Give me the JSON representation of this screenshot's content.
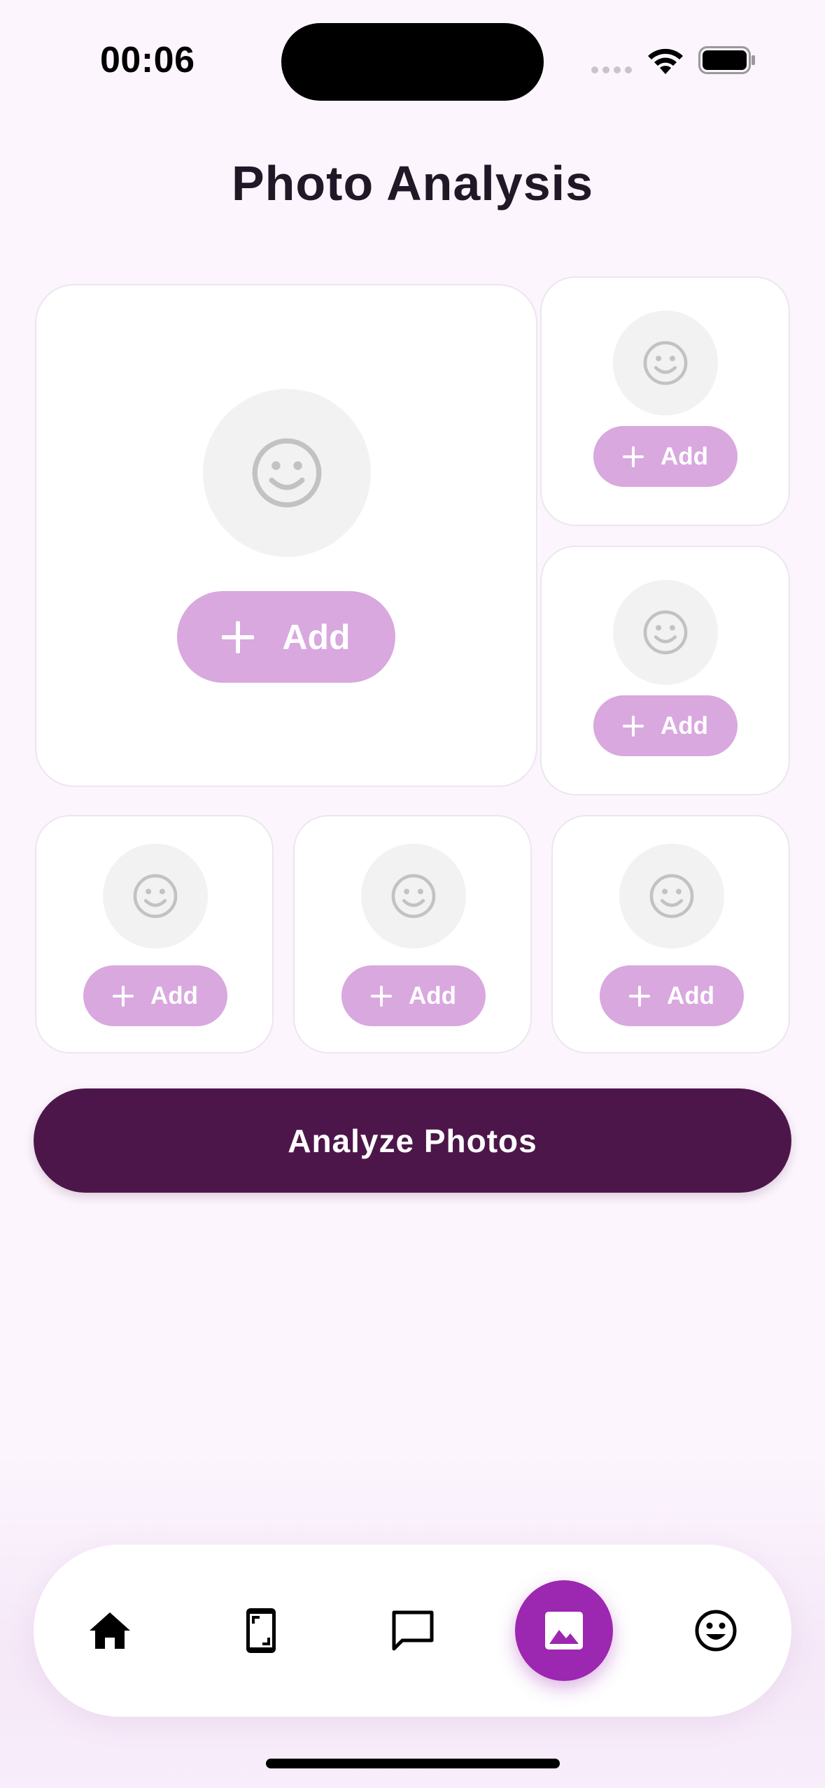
{
  "status_bar": {
    "time": "00:06",
    "icons": [
      "cellular-dots-icon",
      "wifi-icon",
      "battery-icon"
    ]
  },
  "page": {
    "title": "Photo Analysis"
  },
  "photo_slots": {
    "main": {
      "add_label": "Add",
      "icon": "smiley-face-icon"
    },
    "slots": [
      {
        "add_label": "Add",
        "icon": "smiley-face-icon"
      },
      {
        "add_label": "Add",
        "icon": "smiley-face-icon"
      },
      {
        "add_label": "Add",
        "icon": "smiley-face-icon"
      },
      {
        "add_label": "Add",
        "icon": "smiley-face-icon"
      },
      {
        "add_label": "Add",
        "icon": "smiley-face-icon"
      }
    ]
  },
  "actions": {
    "analyze_label": "Analyze Photos"
  },
  "bottom_nav": {
    "items": [
      {
        "icon": "home-icon",
        "active": false
      },
      {
        "icon": "phone-scan-icon",
        "active": false
      },
      {
        "icon": "chat-icon",
        "active": false
      },
      {
        "icon": "image-icon",
        "active": true
      },
      {
        "icon": "face-icon",
        "active": false
      }
    ]
  },
  "colors": {
    "background": "#fcf5fd",
    "add_button": "#d9a8df",
    "analyze_button": "#4d164a",
    "nav_active": "#9c27b0",
    "title_text": "#211827"
  }
}
